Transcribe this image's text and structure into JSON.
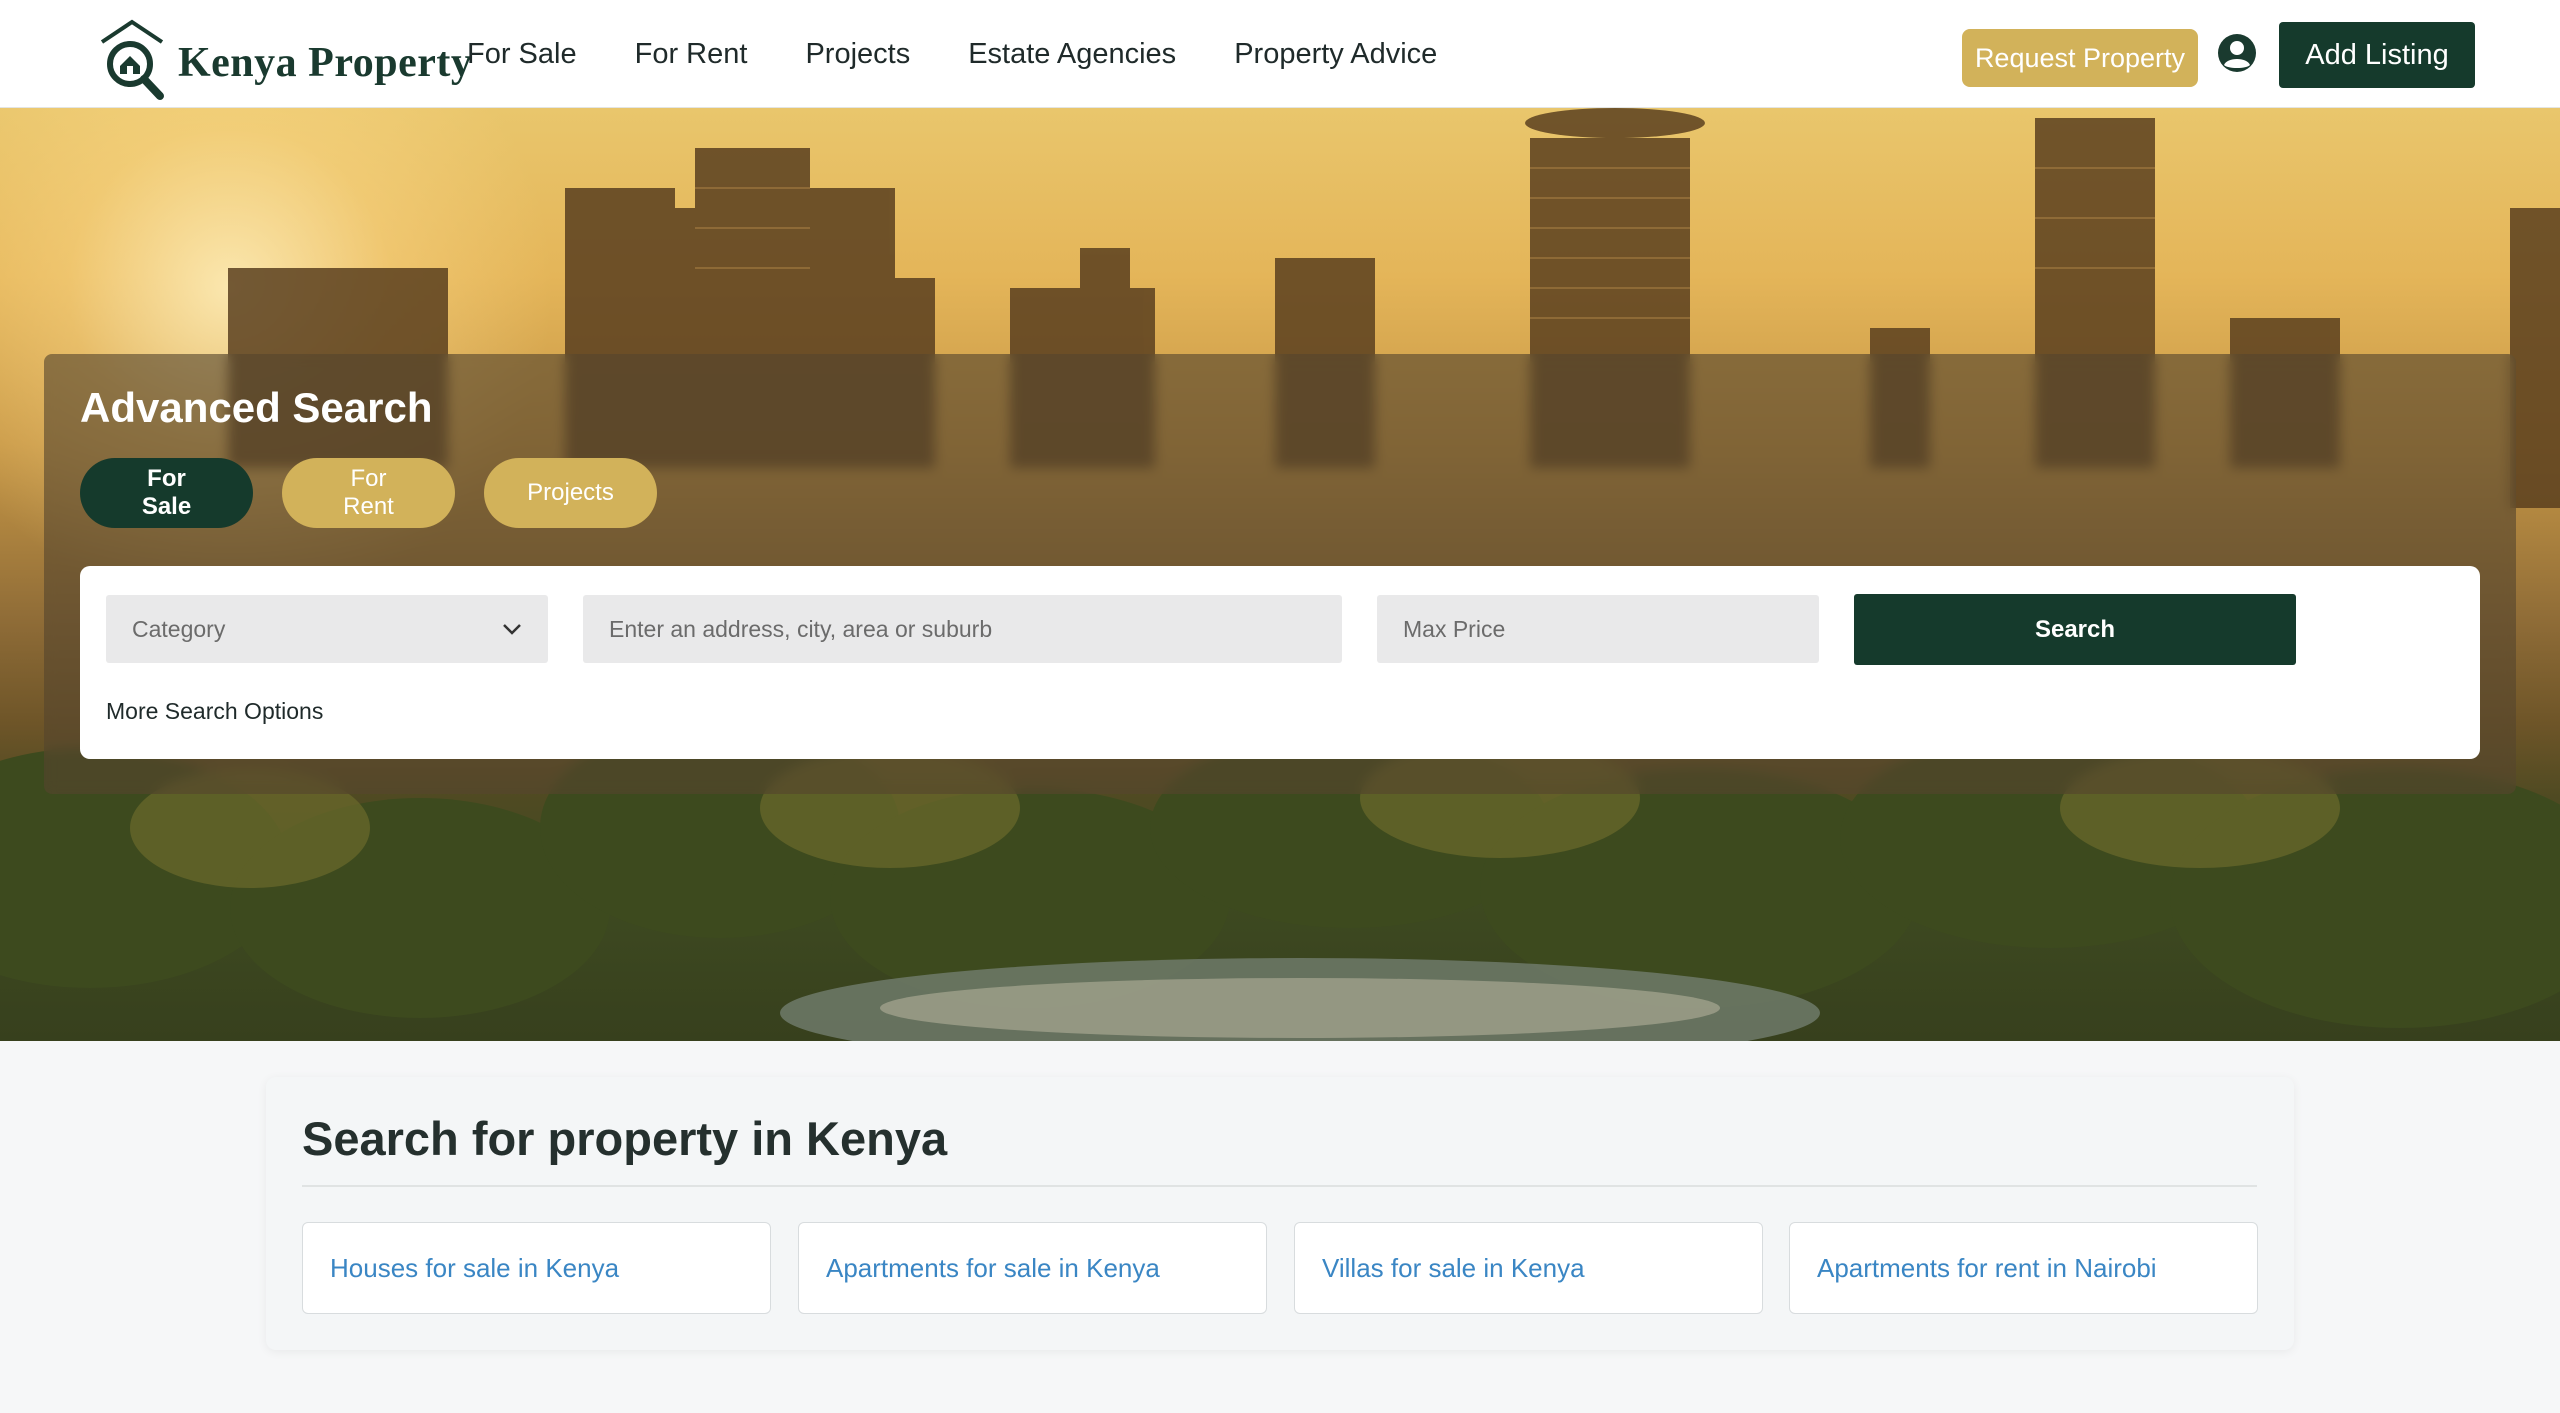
{
  "header": {
    "brand": "Kenya Property",
    "nav": [
      {
        "label": "For Sale"
      },
      {
        "label": "For Rent"
      },
      {
        "label": "Projects"
      },
      {
        "label": "Estate Agencies"
      },
      {
        "label": "Property Advice"
      }
    ],
    "request_label": "Request Property",
    "add_listing_label": "Add Listing"
  },
  "search": {
    "title": "Advanced Search",
    "tabs": [
      {
        "label": "For Sale",
        "active": true
      },
      {
        "label": "For Rent",
        "active": false
      },
      {
        "label": "Projects",
        "active": false
      }
    ],
    "category_value": "Category",
    "address_placeholder": "Enter an address, city, area or suburb",
    "price_placeholder": "Max Price",
    "search_label": "Search",
    "more_options": "More Search Options"
  },
  "links_section": {
    "title": "Search for property in Kenya",
    "links": [
      {
        "label": "Houses for sale in Kenya"
      },
      {
        "label": "Apartments for sale in Kenya"
      },
      {
        "label": "Villas for sale in Kenya"
      },
      {
        "label": "Apartments for rent in Nairobi"
      }
    ]
  },
  "colors": {
    "brand_dark_green": "#153a2c",
    "brand_gold": "#d2b25a",
    "link_blue": "#3a86c4"
  },
  "icons": {
    "logo": "house-magnifier-logo-icon",
    "user": "user-account-icon",
    "chevron": "chevron-down-icon"
  }
}
